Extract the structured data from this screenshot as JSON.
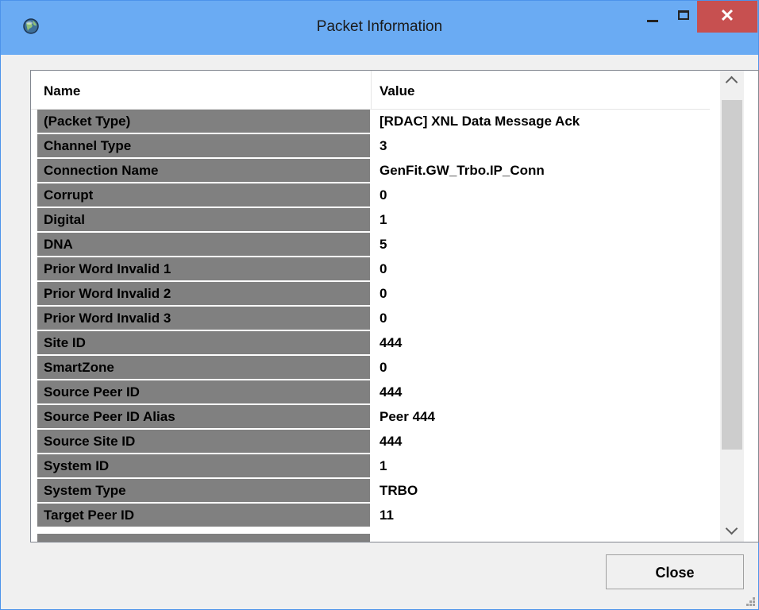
{
  "window": {
    "title": "Packet Information"
  },
  "grid": {
    "columns": [
      "Name",
      "Value"
    ],
    "rows": [
      {
        "name": "(Packet Type)",
        "value": "[RDAC] XNL Data Message Ack"
      },
      {
        "name": "Channel Type",
        "value": "3"
      },
      {
        "name": "Connection Name",
        "value": "GenFit.GW_Trbo.IP_Conn"
      },
      {
        "name": "Corrupt",
        "value": "0"
      },
      {
        "name": "Digital",
        "value": "1"
      },
      {
        "name": "DNA",
        "value": "5"
      },
      {
        "name": "Prior Word Invalid 1",
        "value": "0"
      },
      {
        "name": "Prior Word Invalid 2",
        "value": "0"
      },
      {
        "name": "Prior Word Invalid 3",
        "value": "0"
      },
      {
        "name": "Site ID",
        "value": "444"
      },
      {
        "name": "SmartZone",
        "value": "0"
      },
      {
        "name": "Source Peer ID",
        "value": "444"
      },
      {
        "name": "Source Peer ID Alias",
        "value": "Peer 444"
      },
      {
        "name": "Source Site ID",
        "value": "444"
      },
      {
        "name": "System ID",
        "value": "1"
      },
      {
        "name": "System Type",
        "value": "TRBO"
      },
      {
        "name": "Target Peer ID",
        "value": "11"
      }
    ]
  },
  "buttons": {
    "close_label": "Close"
  },
  "icons": {
    "app": "globe-icon",
    "minimize": "minimize-icon",
    "maximize": "maximize-icon",
    "close": "close-icon"
  },
  "colors": {
    "titlebar": "#6aabf3",
    "close_hover": "#c75050",
    "name_cell": "#808080"
  }
}
